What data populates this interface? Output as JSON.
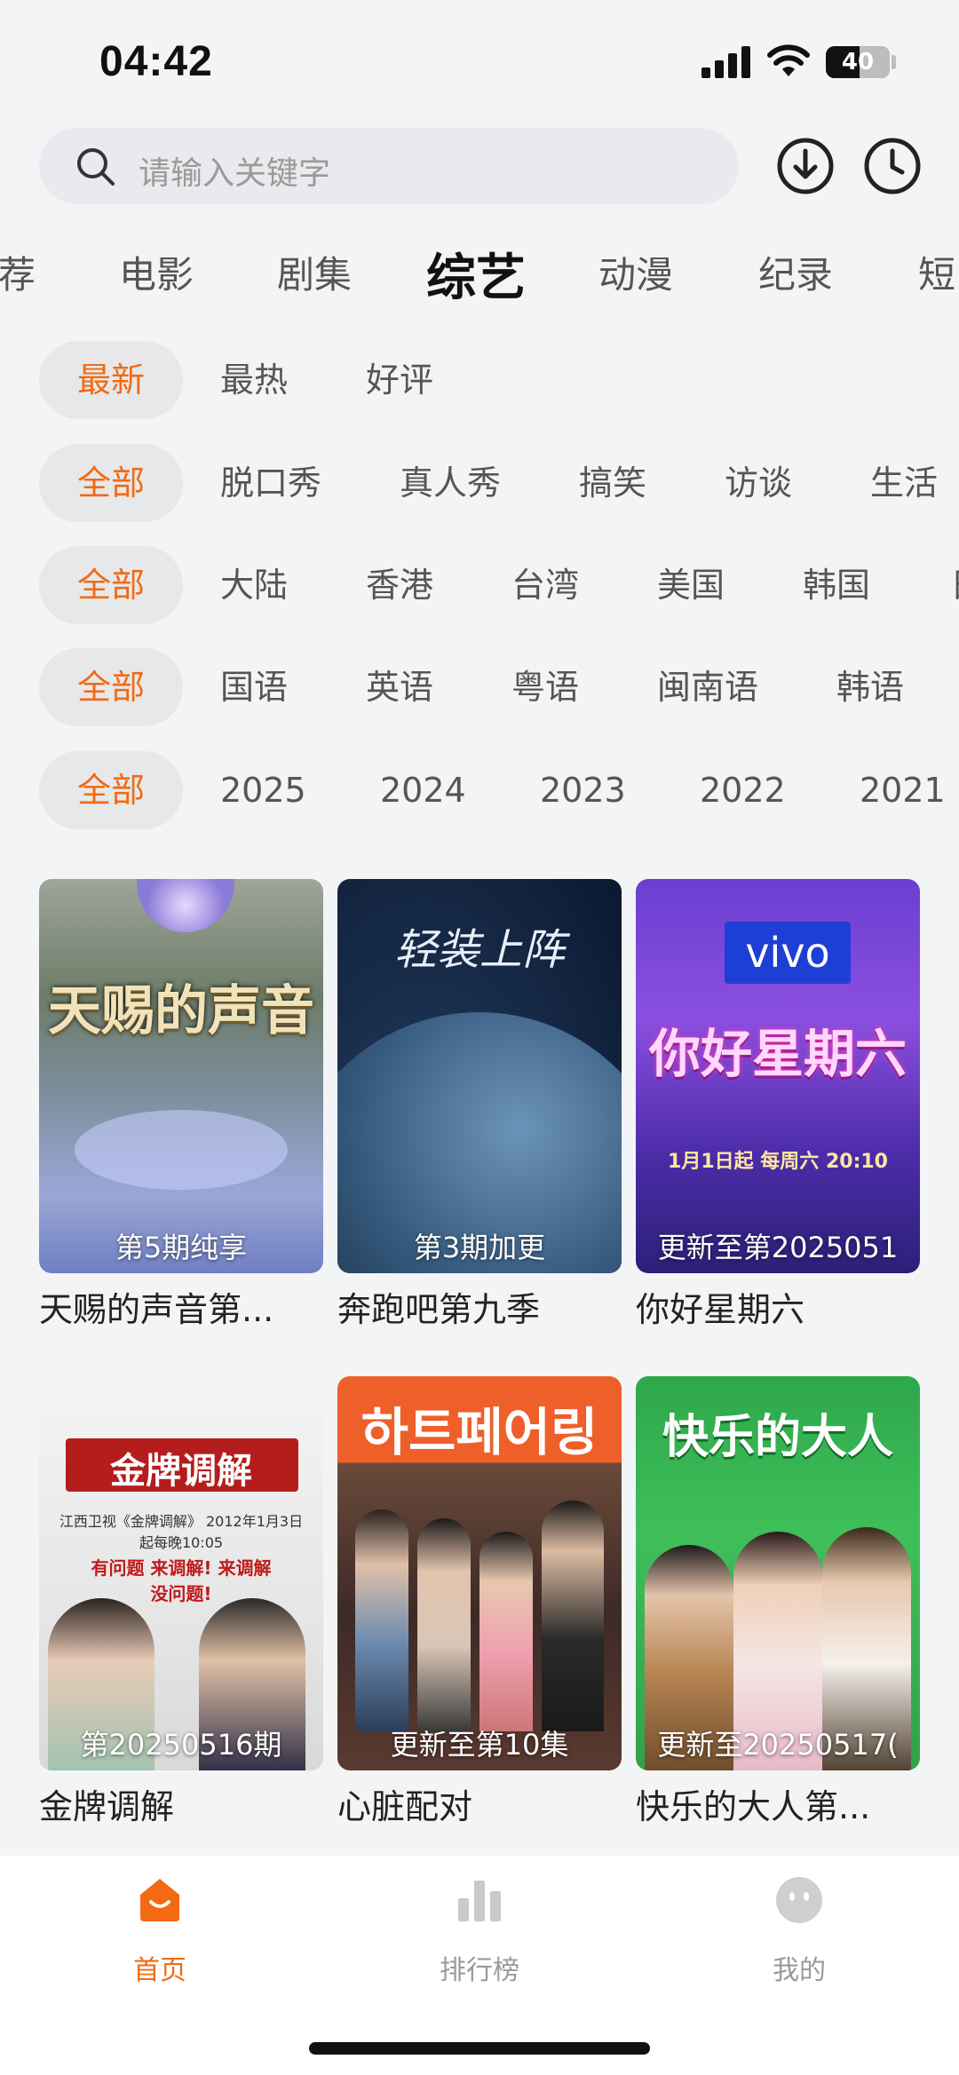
{
  "status": {
    "time": "04:42",
    "battery": "40"
  },
  "search": {
    "placeholder": "请输入关键字"
  },
  "categories": [
    "荐",
    "电影",
    "剧集",
    "综艺",
    "动漫",
    "纪录",
    "短"
  ],
  "filters": {
    "sort": [
      "最新",
      "最热",
      "好评"
    ],
    "genre": [
      "全部",
      "脱口秀",
      "真人秀",
      "搞笑",
      "访谈",
      "生活"
    ],
    "region": [
      "全部",
      "大陆",
      "香港",
      "台湾",
      "美国",
      "韩国",
      "日"
    ],
    "language": [
      "全部",
      "国语",
      "英语",
      "粤语",
      "闽南语",
      "韩语"
    ],
    "year": [
      "全部",
      "2025",
      "2024",
      "2023",
      "2022",
      "2021"
    ]
  },
  "cards": [
    {
      "title": "天赐的声音第...",
      "badge": "第5期纯享",
      "poster_text": "天赐的声音"
    },
    {
      "title": "奔跑吧第九季",
      "badge": "第3期加更",
      "poster_text": "轻装上阵"
    },
    {
      "title": "你好星期六",
      "badge": "更新至第2025051",
      "poster_text": "你好星期六",
      "poster_brand": "vivo",
      "poster_sub": "1月1日起 每周六 20:10"
    },
    {
      "title": "金牌调解",
      "badge": "第20250516期",
      "poster_text": "金牌调解",
      "poster_sub": "江西卫视《金牌调解》 2012年1月3日起每晚10:05",
      "poster_sub2": "有问题 来调解! 来调解 没问题!"
    },
    {
      "title": "心脏配对",
      "badge": "更新至第10集",
      "poster_text": "하트페어링"
    },
    {
      "title": "快乐的大人第...",
      "badge": "更新至20250517(",
      "poster_text": "快乐的大人"
    }
  ],
  "tabbar": {
    "home": "首页",
    "rank": "排行榜",
    "me": "我的"
  },
  "colors": {
    "accent": "#f26a14",
    "inactive": "#9a9a9a"
  }
}
